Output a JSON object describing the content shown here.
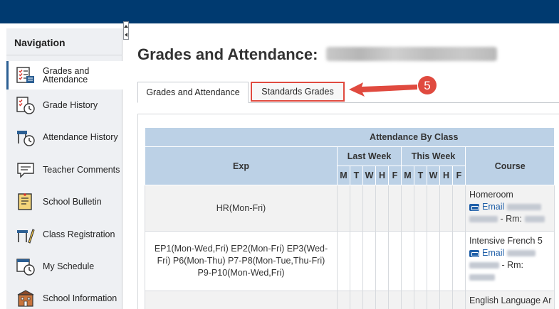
{
  "navigation": {
    "heading": "Navigation",
    "items": [
      {
        "label": "Grades and Attendance",
        "icon": "gradebook-icon",
        "active": true
      },
      {
        "label": "Grade History",
        "icon": "grade-history-icon"
      },
      {
        "label": "Attendance History",
        "icon": "attendance-history-icon"
      },
      {
        "label": "Teacher Comments",
        "icon": "comment-icon"
      },
      {
        "label": "School Bulletin",
        "icon": "bulletin-icon"
      },
      {
        "label": "Class Registration",
        "icon": "desk-icon"
      },
      {
        "label": "My Schedule",
        "icon": "schedule-icon"
      },
      {
        "label": "School Information",
        "icon": "school-icon"
      }
    ]
  },
  "page": {
    "title": "Grades and Attendance:"
  },
  "tabs": {
    "grades_attendance": "Grades and Attendance",
    "standards_grades": "Standards Grades"
  },
  "annotation": {
    "step": "5"
  },
  "table": {
    "group_header": "Attendance By Class",
    "col_exp": "Exp",
    "col_last_week": "Last Week",
    "col_this_week": "This Week",
    "col_course": "Course",
    "days": [
      "M",
      "T",
      "W",
      "H",
      "F"
    ],
    "rows": [
      {
        "exp": "HR(Mon-Fri)",
        "course": "Homeroom",
        "email": "Email",
        "rm": "- Rm:"
      },
      {
        "exp": "EP1(Mon-Wed,Fri) EP2(Mon-Fri) EP3(Wed-Fri) P6(Mon-Thu) P7-P8(Mon-Tue,Thu-Fri) P9-P10(Mon-Wed,Fri)",
        "course": "Intensive French 5",
        "email": "Email",
        "rm": "- Rm:"
      },
      {
        "exp": "",
        "course": "English Language Ar"
      }
    ]
  },
  "colors": {
    "topbar": "#003a70",
    "header_cell": "#bcd1e6",
    "highlight": "#e04a3f",
    "link": "#1f5fa8"
  }
}
